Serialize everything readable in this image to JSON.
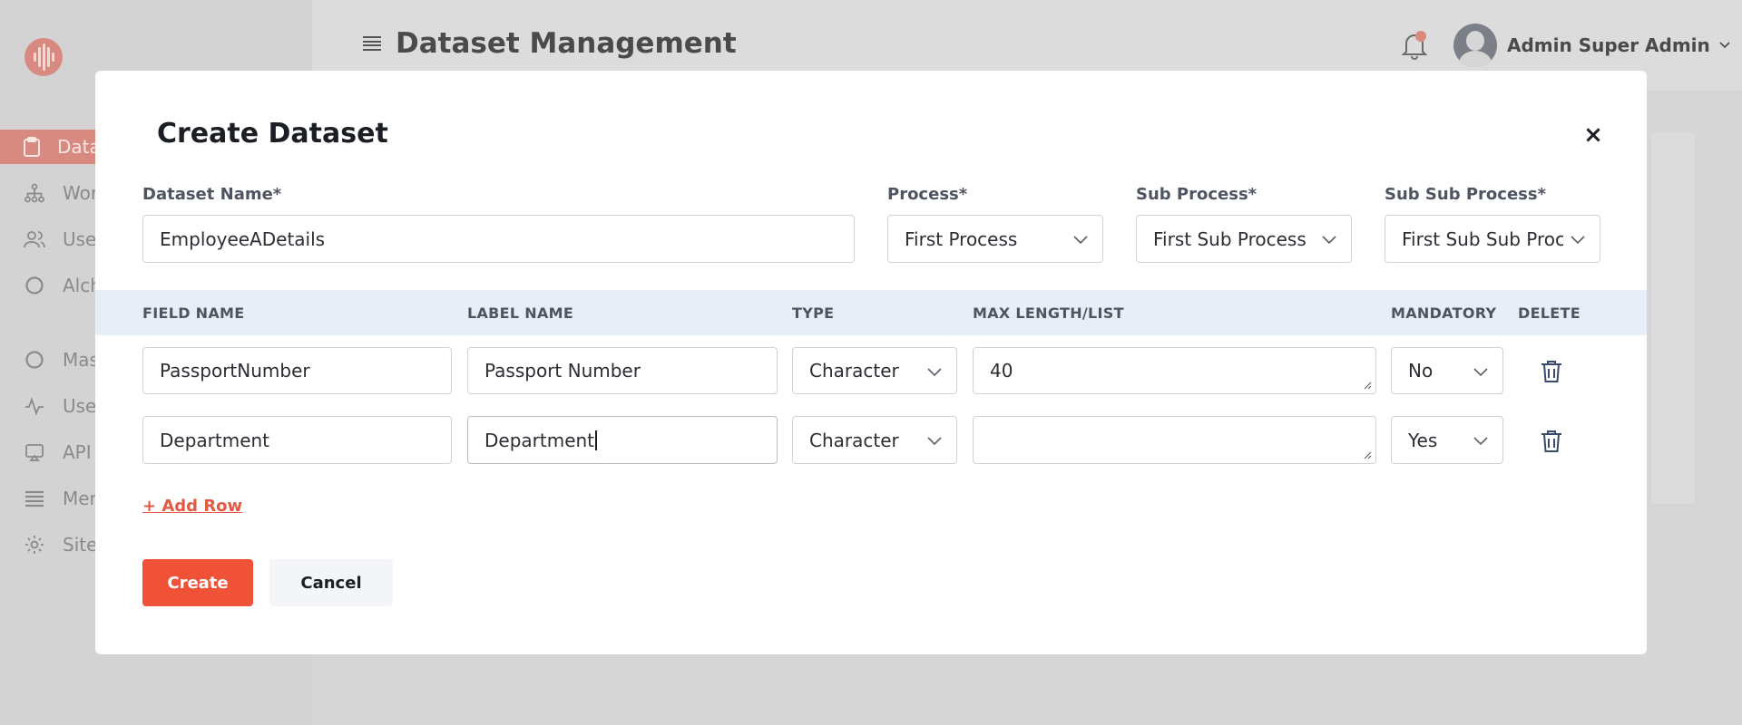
{
  "app": {
    "page_title": "Dataset Management",
    "user_name": "Admin Super Admin",
    "sidebar": {
      "items": [
        {
          "label": "Data",
          "icon": "clipboard-icon",
          "active": true
        },
        {
          "label": "Wor",
          "icon": "sitemap-icon"
        },
        {
          "label": "Use",
          "icon": "users-icon"
        },
        {
          "label": "Alch",
          "icon": "circle-icon"
        },
        {
          "label": "Mas",
          "icon": "circle-icon"
        },
        {
          "label": "Use",
          "icon": "activity-icon"
        },
        {
          "label": "API",
          "icon": "monitor-icon"
        },
        {
          "label": "Men",
          "icon": "list-icon"
        },
        {
          "label": "Site",
          "icon": "gear-icon"
        }
      ]
    }
  },
  "modal": {
    "title": "Create Dataset",
    "close_label": "×",
    "dataset_name": {
      "label": "Dataset Name*",
      "value": "EmployeeADetails"
    },
    "process": {
      "label": "Process*",
      "value": "First Process"
    },
    "sub_process": {
      "label": "Sub Process*",
      "value": "First Sub Process"
    },
    "sub_sub_process": {
      "label": "Sub Sub Process*",
      "value": "First Sub Sub Proc"
    },
    "table": {
      "headers": [
        "FIELD NAME",
        "LABEL NAME",
        "TYPE",
        "MAX LENGTH/LIST",
        "MANDATORY",
        "DELETE"
      ],
      "rows": [
        {
          "field_name": "PassportNumber",
          "label_name": "Passport Number",
          "type": "Character",
          "max_length": "40",
          "mandatory": "No"
        },
        {
          "field_name": "Department",
          "label_name": "Department",
          "type": "Character",
          "max_length": "",
          "mandatory": "Yes"
        }
      ]
    },
    "add_row_label": "+ Add Row",
    "create_label": "Create",
    "cancel_label": "Cancel"
  },
  "colors": {
    "accent": "#f05238",
    "table_header_bg": "#e8eef7",
    "overlay": "#d5d5d5"
  }
}
